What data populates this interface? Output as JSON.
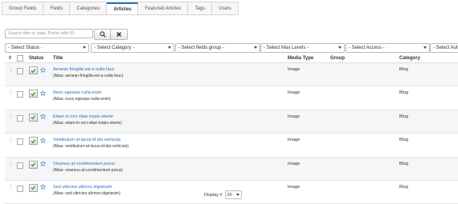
{
  "tabs": [
    "Group Fields",
    "Fields",
    "Categories",
    "Articles",
    "Featured Articles",
    "Tags",
    "Users"
  ],
  "active_tab": "Articles",
  "search": {
    "placeholder": "Search title or alias. Prefix with ID:"
  },
  "filters": [
    "- Select Status -",
    "- Select Category -",
    "- Select fields group -",
    "- Select Max Levels -",
    "- Select Access -",
    "- Select Aut"
  ],
  "table": {
    "headers": {
      "status": "Status",
      "title": "Title",
      "media_type": "Media Type",
      "group": "Group",
      "category": "Category"
    },
    "rows": [
      {
        "title": "Aenean fringilla est a nulla fauc",
        "alias": "(Alias: aenean-fringilla-est-a-nulla-fauc)",
        "media_type": "Image",
        "group": "",
        "category": "Blog"
      },
      {
        "title": "Nunc egestas nulla enim",
        "alias": "(Alias: nunc-egestas-nulla-enim)",
        "media_type": "Image",
        "group": "",
        "category": "Blog"
      },
      {
        "title": "Etiam in orci vitae turpis eleme",
        "alias": "(Alias: etiam-in-orci-vitae-turpis-eleme)",
        "media_type": "Image",
        "group": "",
        "category": "Blog"
      },
      {
        "title": "Vestibulum at lacus id dui vehicula",
        "alias": "(Alias: vestibulum-at-lacus-id-dui-vehicula)",
        "media_type": "Image",
        "group": "",
        "category": "Blog"
      },
      {
        "title": "Vivamus at condimentum purus",
        "alias": "(Alias: vivamus-at-condimentum-purus)",
        "media_type": "Image",
        "group": "",
        "category": "Blog"
      },
      {
        "title": "Sed ultricies ultrices dignissim",
        "alias": "(Alias: sed-ultricies-ultrices-dignissim)",
        "media_type": "Image",
        "group": "",
        "category": "Blog"
      }
    ]
  },
  "footer": {
    "display_label": "Display #",
    "limit_value": "20"
  },
  "colors": {
    "link": "#2a6ebb",
    "published_check": "#4a8a2a"
  },
  "icons": {
    "search": "search-icon",
    "clear": "close-icon",
    "published": "check-icon",
    "featured": "star-icon",
    "drag": "drag-handle-icon",
    "sort": "sort-icon"
  }
}
